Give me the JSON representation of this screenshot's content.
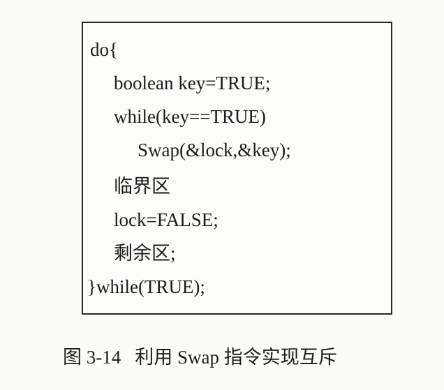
{
  "code": {
    "lines": [
      "do{",
      "boolean key=TRUE;",
      "while(key==TRUE)",
      "Swap(&lock,&key);",
      "临界区",
      "lock=FALSE;",
      "剩余区;",
      "}while(TRUE);"
    ]
  },
  "caption": {
    "label": "图 3-14",
    "text": "利用 Swap 指令实现互斥"
  }
}
